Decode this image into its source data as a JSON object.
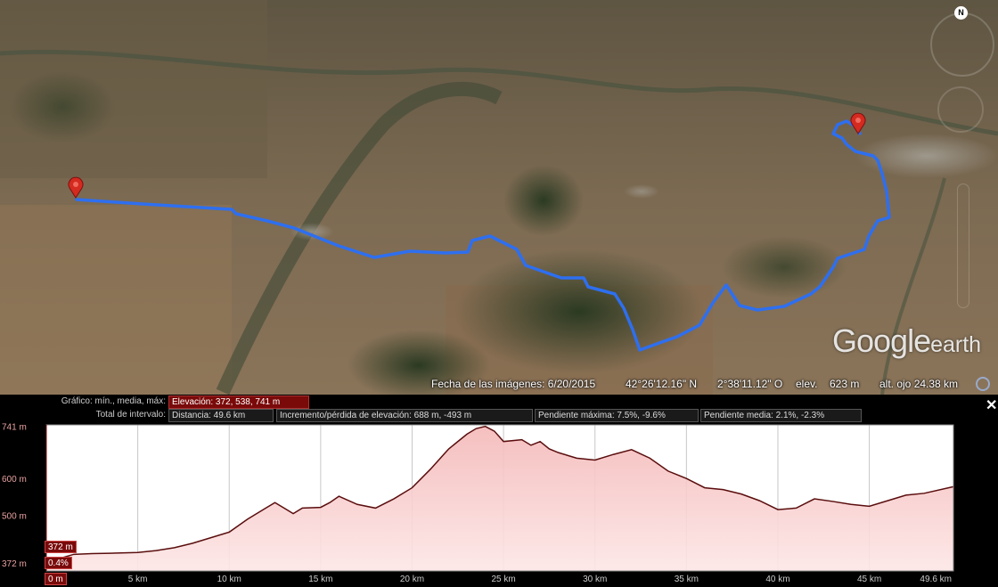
{
  "status": {
    "imagery_date": "Fecha de las imágenes: 6/20/2015",
    "lat": "42°26'12.16\" N",
    "lon": "2°38'11.12\" O",
    "elev_label": "elev.",
    "elev_value": "623 m",
    "eye_alt": "alt. ojo  24.38 km"
  },
  "logo": {
    "google": "Google",
    "earth": "earth"
  },
  "compass": {
    "north": "N"
  },
  "panel": {
    "graph_label": "Gráfico: mín., media, máx:",
    "elevation_box": "Elevación: 372, 538, 741 m",
    "interval_label": "Total de intervalo:",
    "distance_box": "Distancia: 49.6 km",
    "gain_box": "Incremento/pérdida de elevación: 688 m, -493 m",
    "max_slope_box": "Pendiente máxima: 7.5%, -9.6%",
    "avg_slope_box": "Pendiente media: 2.1%, -2.3%",
    "close": "✕"
  },
  "cursor": {
    "elevation": "372 m",
    "slope": "0.4%",
    "distance": "0 m"
  },
  "colors": {
    "route": "#2e6ff0",
    "fill": "#f4b8b8",
    "line": "#5a0d0d",
    "accent": "#7a0a0a"
  },
  "chart_data": {
    "type": "area",
    "title": "",
    "xlabel": "",
    "ylabel": "",
    "xlim": [
      0,
      49.6
    ],
    "ylim": [
      350,
      745
    ],
    "x_ticks": [
      5,
      10,
      15,
      20,
      25,
      30,
      35,
      40,
      45
    ],
    "x_tick_labels": [
      "5 km",
      "10 km",
      "15 km",
      "20 km",
      "25 km",
      "30 km",
      "35 km",
      "40 km",
      "45 km"
    ],
    "x_end_label": "49.6 km",
    "y_ticks": [
      372,
      500,
      600,
      741
    ],
    "y_tick_labels": [
      "372 m",
      "500 m",
      "600 m",
      "741 m"
    ],
    "grid": true,
    "series": [
      {
        "x": [
          0,
          0.8,
          1.5,
          2.5,
          3.5,
          5,
          6,
          7,
          8,
          9,
          10,
          11,
          12,
          12.5,
          13,
          13.5,
          14,
          15,
          15.5,
          16,
          17,
          18,
          19,
          20,
          21,
          22,
          23,
          23.5,
          24,
          24.5,
          25,
          26,
          26.5,
          27,
          27.5,
          28,
          29,
          30,
          31,
          32,
          33,
          34,
          35,
          36,
          37,
          38,
          39,
          40,
          41,
          42,
          43,
          44,
          45,
          46,
          47,
          48,
          49.6
        ],
        "y": [
          372,
          385,
          395,
          397,
          398,
          400,
          405,
          413,
          425,
          440,
          455,
          490,
          520,
          535,
          520,
          505,
          520,
          522,
          535,
          552,
          530,
          520,
          545,
          575,
          625,
          680,
          720,
          735,
          741,
          728,
          700,
          705,
          690,
          700,
          680,
          670,
          655,
          650,
          665,
          678,
          655,
          620,
          600,
          575,
          570,
          558,
          540,
          516,
          520,
          545,
          538,
          530,
          525,
          540,
          555,
          560,
          578
        ]
      }
    ]
  }
}
